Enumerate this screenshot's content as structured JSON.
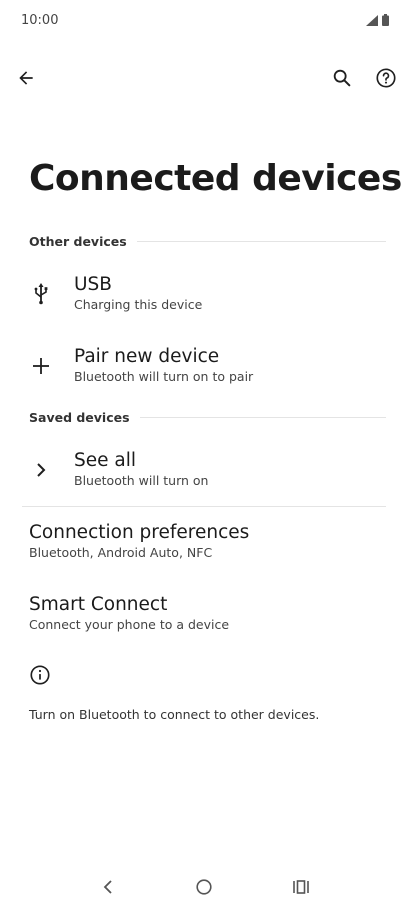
{
  "status_bar": {
    "time": "10:00"
  },
  "page": {
    "title": "Connected devices"
  },
  "sections": {
    "other": {
      "label": "Other devices"
    },
    "saved": {
      "label": "Saved devices"
    }
  },
  "items": {
    "usb": {
      "title": "USB",
      "subtitle": "Charging this device"
    },
    "pair": {
      "title": "Pair new device",
      "subtitle": "Bluetooth will turn on to pair"
    },
    "see_all": {
      "title": "See all",
      "subtitle": "Bluetooth will turn on"
    },
    "connection_prefs": {
      "title": "Connection preferences",
      "subtitle": "Bluetooth, Android Auto, NFC"
    },
    "smart_connect": {
      "title": "Smart Connect",
      "subtitle": "Connect your phone to a device"
    }
  },
  "footer": {
    "info_text": "Turn on Bluetooth to connect to other devices."
  },
  "icons": {
    "back": "back-arrow-icon",
    "search": "search-icon",
    "help": "help-icon",
    "usb": "usb-icon",
    "plus": "plus-icon",
    "chevron": "chevron-right-icon",
    "info": "info-icon"
  }
}
